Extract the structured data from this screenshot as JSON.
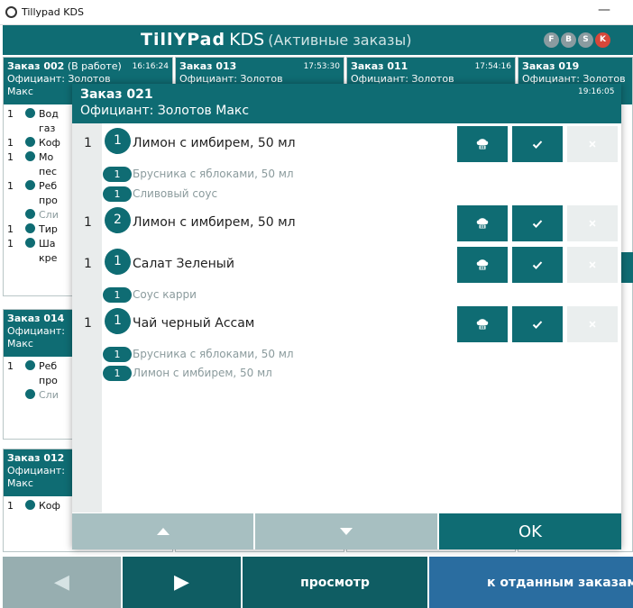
{
  "window": {
    "title": "Tillypad KDS",
    "minimize": "—"
  },
  "header": {
    "logo_brand": "TillYPad",
    "logo_suffix": "KDS",
    "mode": "(Активные заказы)",
    "badges": [
      "F",
      "B",
      "S",
      "K"
    ],
    "badge_colors": {
      "default": "#8a9ba0",
      "active": "#d8473a"
    }
  },
  "background_orders": [
    {
      "title": "Заказ 002",
      "status": "(В работе)",
      "time": "16:16:24",
      "waiter_line1": "Официант: Золотов",
      "waiter_line2": "Макс",
      "rows": [
        [
          "1",
          "Вод"
        ],
        [
          "",
          "газ"
        ],
        [
          "1",
          "Коф"
        ],
        [
          "1",
          "Мо"
        ],
        [
          "",
          "пес"
        ],
        [
          "1",
          "Реб"
        ],
        [
          "",
          "про"
        ],
        [
          "",
          "Сли"
        ],
        [
          "1",
          "Тир"
        ],
        [
          "1",
          "Ша"
        ],
        [
          "",
          "кре"
        ]
      ]
    },
    {
      "title": "Заказ 013",
      "status": "",
      "time": "17:53:30",
      "waiter_line1": "Официант: Золотов",
      "waiter_line2": "",
      "rows": []
    },
    {
      "title": "Заказ 011",
      "status": "",
      "time": "17:54:16",
      "waiter_line1": "Официант: Золотов",
      "waiter_line2": "",
      "rows": []
    },
    {
      "title": "Заказ 019",
      "status": "",
      "time": "",
      "waiter_line1": "Официант: Золотов",
      "waiter_line2": "",
      "rows": []
    },
    {
      "title": "Заказ 014",
      "status": "",
      "time": "",
      "waiter_line1": "Официант:",
      "waiter_line2": "Макс",
      "rows": [
        [
          "1",
          "Реб"
        ],
        [
          "",
          "про"
        ],
        [
          "",
          "Сли"
        ]
      ]
    },
    {
      "title": "Заказ 012",
      "status": "",
      "time": "",
      "waiter_line1": "Официант:",
      "waiter_line2": "Макс",
      "rows": [
        [
          "1",
          "Коф"
        ]
      ]
    }
  ],
  "bottom_bar": {
    "prev": "◀",
    "next": "▶",
    "view": "просмотр",
    "done": "к отданным заказам"
  },
  "modal": {
    "title": "Заказ 021",
    "waiter": "Официант: Золотов Макс",
    "time": "19:16:05",
    "items": [
      {
        "qty": "1",
        "course": "1",
        "name": "Лимон с имбирем, 50 мл",
        "modifiers": [
          {
            "qty": "1",
            "name": "Брусника с яблоками, 50 мл"
          },
          {
            "qty": "1",
            "name": "Сливовый соус"
          }
        ]
      },
      {
        "qty": "1",
        "course": "2",
        "name": "Лимон с имбирем, 50 мл",
        "modifiers": []
      },
      {
        "qty": "1",
        "course": "1",
        "name": "Салат Зеленый",
        "modifiers": [
          {
            "qty": "1",
            "name": "Соус карри"
          }
        ]
      },
      {
        "qty": "1",
        "course": "1",
        "name": "Чай черный Ассам",
        "modifiers": [
          {
            "qty": "1",
            "name": "Брусника с яблоками, 50 мл"
          },
          {
            "qty": "1",
            "name": "Лимон с имбирем, 50 мл"
          }
        ]
      }
    ],
    "ok_label": "OK"
  }
}
